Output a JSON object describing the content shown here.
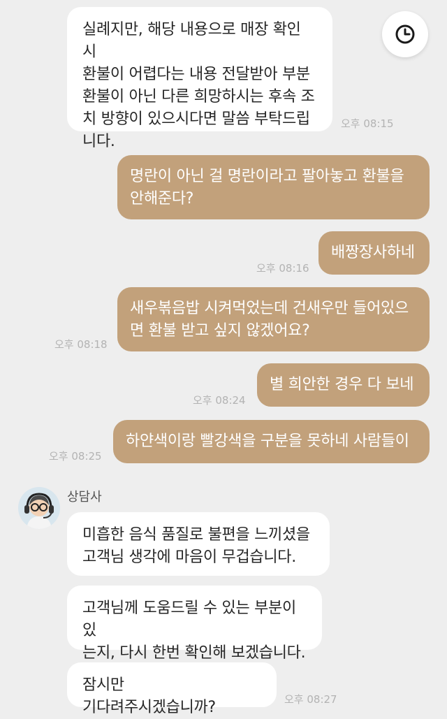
{
  "messages": [
    {
      "text": "실례지만, 해당 내용으로 매장 확인 시\n환불이 어렵다는 내용 전달받아 부분\n환불이 아닌 다른 희망하시는 후속 조\n치 방향이 있으시다면 말씀 부탁드립\n니다.",
      "time": "오후 08:15"
    },
    {
      "text": "명란이 아닌 걸 명란이라고 팔아놓고 환불을\n안해준다?"
    },
    {
      "text": "배짱장사하네",
      "time": "오후 08:16"
    },
    {
      "text": "새우볶음밥 시켜먹었는데 건새우만 들어있으\n면 환불 받고 싶지 않겠어요?",
      "time": "오후 08:18"
    },
    {
      "text": "별 희안한 경우 다 보네",
      "time": "오후 08:24"
    },
    {
      "text": "하얀색이랑 빨강색을 구분을 못하네 사람들이",
      "time": "오후 08:25"
    },
    {
      "text": "미흡한 음식 품질로 불편을 느끼셨을\n고객님 생각에 마음이 무겁습니다."
    },
    {
      "text": "고객님께 도움드릴 수 있는 부분이 있\n는지, 다시 한번 확인해 보겠습니다."
    },
    {
      "text": "잠시만 기다려주시겠습니까?",
      "time": "오후 08:27"
    }
  ],
  "agent": {
    "name": "상담사",
    "avatar_icon": "agent-avatar-icon"
  },
  "history_button": {
    "icon": "clock-icon"
  },
  "colors": {
    "background": "#eeeeee",
    "incoming_bubble": "#ffffff",
    "outgoing_bubble": "#c2a17b",
    "timestamp": "#b3b3b3"
  }
}
